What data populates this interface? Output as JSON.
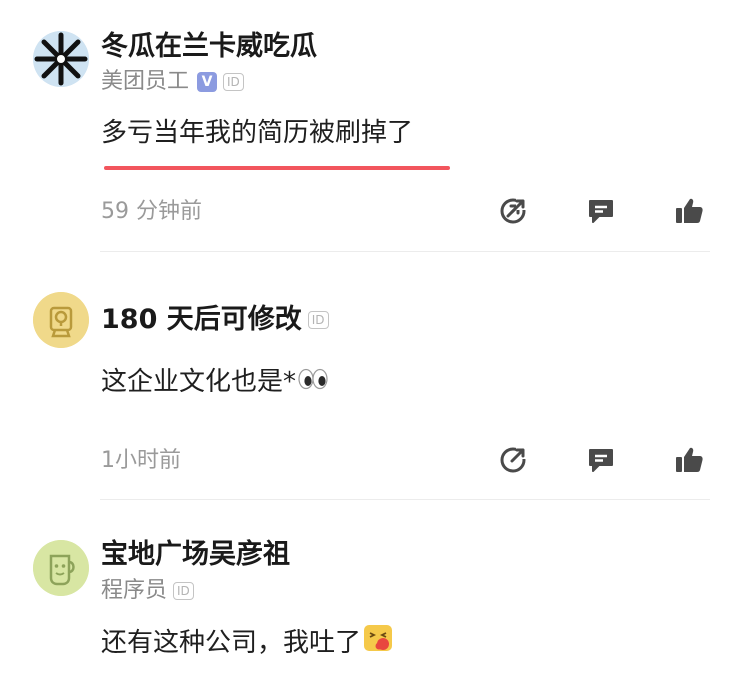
{
  "comments": [
    {
      "author": "冬瓜在兰卡威吃瓜",
      "role": "美团员工",
      "verified_label": "V",
      "id_label": "ID",
      "text": "多亏当年我的简历被刷掉了",
      "time": "59 分钟前",
      "avatar": "windmill-avatar"
    },
    {
      "author": "180 天后可修改",
      "role": "",
      "id_label": "ID",
      "text": "这企业文化也是*",
      "text_emoji": "eyes-emoji",
      "time": "1小时前",
      "avatar": "anonymous-lock-avatar"
    },
    {
      "author": "宝地广场吴彦祖",
      "role": "程序员",
      "id_label": "ID",
      "text": "还有这种公司，我吐了",
      "text_emoji": "vomit-emoji",
      "avatar": "cup-avatar"
    }
  ],
  "actions": [
    "share-icon",
    "reply-icon",
    "like-icon"
  ],
  "colors": {
    "highlight_underline": "#f2555d",
    "verified_badge": "#8c9be0",
    "muted_text": "#9a9a9a"
  }
}
